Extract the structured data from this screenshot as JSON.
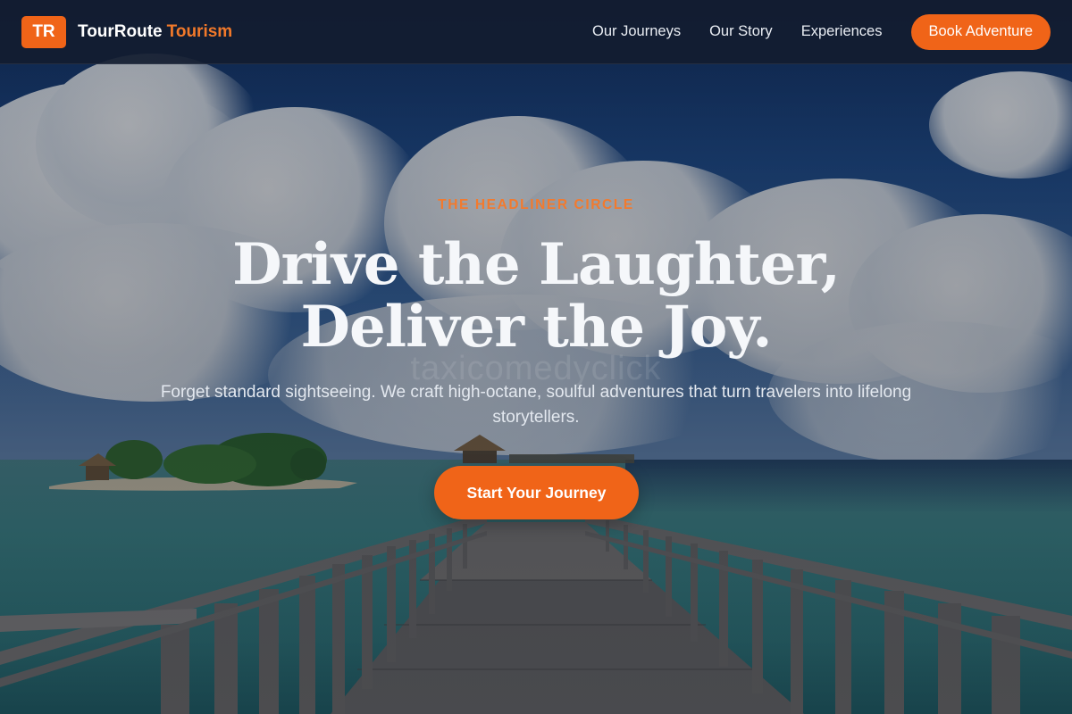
{
  "brand": {
    "mark": "TR",
    "name": "TourRoute",
    "accent": "Tourism"
  },
  "nav": {
    "links": [
      {
        "label": "Our Journeys"
      },
      {
        "label": "Our Story"
      },
      {
        "label": "Experiences"
      }
    ],
    "cta_label": "Book Adventure"
  },
  "hero": {
    "kicker": "THE HEADLINER CIRCLE",
    "headline_line1": "Drive the Laughter,",
    "headline_line2": "Deliver the Joy.",
    "subhead": "Forget standard sightseeing. We craft high-octane, soulful adventures that turn travelers into lifelong storytellers.",
    "cta_label": "Start Your Journey",
    "watermark": "taxicomedyclick"
  },
  "colors": {
    "accent": "#f06418",
    "accent_text": "#f2792a",
    "navbar_bg": "#121c30",
    "headline": "#f5f7fa"
  },
  "icons": {
    "logo": "tr-logo-icon"
  }
}
